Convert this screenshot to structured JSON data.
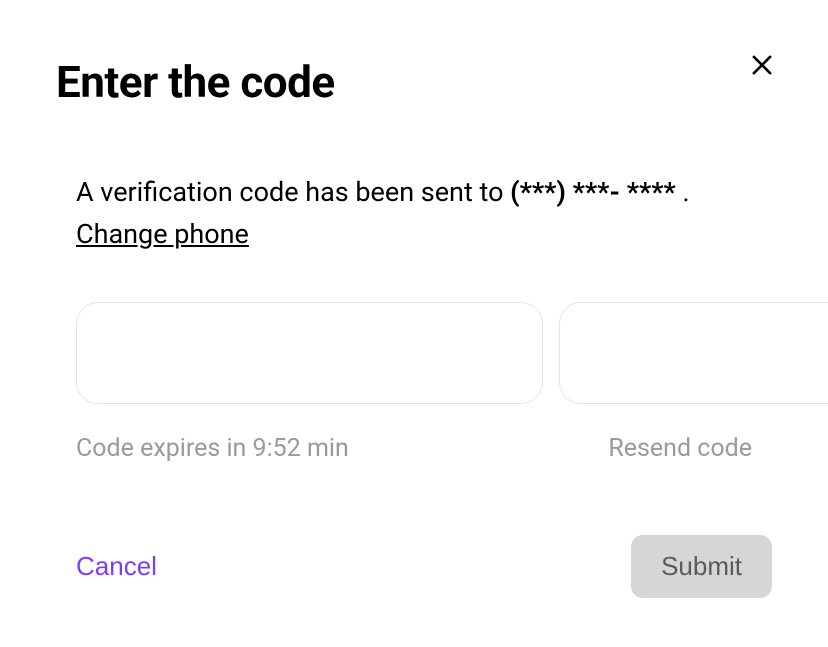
{
  "title": "Enter the code",
  "description": {
    "prefix": "A verification code has been sent to ",
    "masked_phone": "(***) ***- ****",
    "separator": " . ",
    "change_link": "Change phone"
  },
  "code_inputs": {
    "count": 6,
    "values": [
      "",
      "",
      "",
      "",
      "",
      ""
    ]
  },
  "expiry_text": "Code expires in 9:52 min",
  "resend_text": "Resend code",
  "actions": {
    "cancel": "Cancel",
    "submit": "Submit"
  },
  "colors": {
    "accent": "#7d3cff",
    "disabled_bg": "#d6d6d6",
    "disabled_text": "#5b5b5b",
    "border": "#e5e5e8",
    "muted": "#9a9a9a"
  }
}
